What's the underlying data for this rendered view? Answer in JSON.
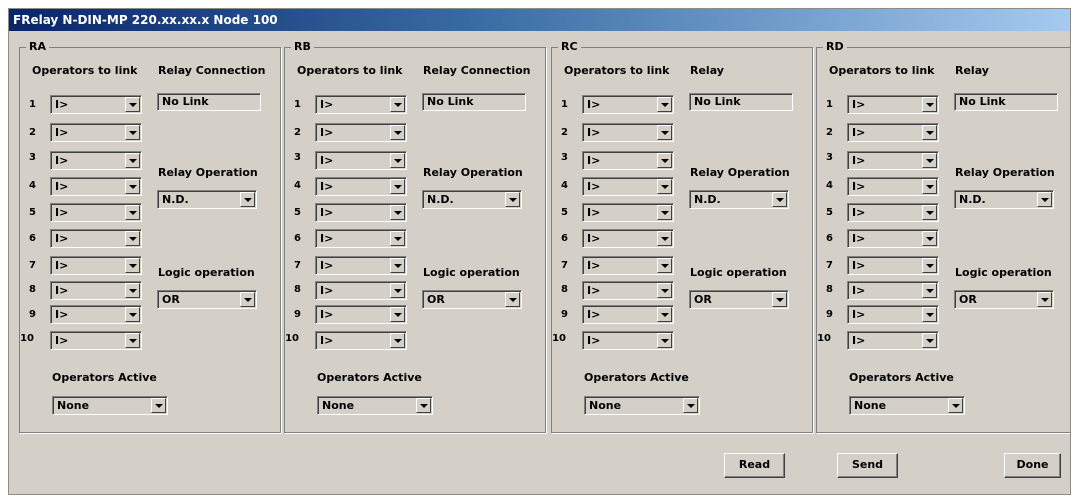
{
  "window": {
    "title": "FRelay N-DIN-MP 220.xx.xx.x Node 100"
  },
  "panels": [
    {
      "name": "RA",
      "operators_header": "Operators to link",
      "relay_header": "Relay Connection",
      "relay_value": "No Link",
      "relay_operation_label": "Relay Operation",
      "relay_operation_value": "N.D.",
      "logic_label": "Logic operation",
      "logic_value": "OR",
      "operators_active_label": "Operators Active",
      "operators_active_value": "None",
      "operators": [
        "I>",
        "I>",
        "I>",
        "I>",
        "I>",
        "I>",
        "I>",
        "I>",
        "I>",
        "I>"
      ]
    },
    {
      "name": "RB",
      "operators_header": "Operators to link",
      "relay_header": "Relay Connection",
      "relay_value": "No Link",
      "relay_operation_label": "Relay Operation",
      "relay_operation_value": "N.D.",
      "logic_label": "Logic operation",
      "logic_value": "OR",
      "operators_active_label": "Operators Active",
      "operators_active_value": "None",
      "operators": [
        "I>",
        "I>",
        "I>",
        "I>",
        "I>",
        "I>",
        "I>",
        "I>",
        "I>",
        "I>"
      ]
    },
    {
      "name": "RC",
      "operators_header": "Operators to link",
      "relay_header": "Relay",
      "relay_value": "No Link",
      "relay_operation_label": "Relay Operation",
      "relay_operation_value": "N.D.",
      "logic_label": "Logic operation",
      "logic_value": "OR",
      "operators_active_label": "Operators Active",
      "operators_active_value": "None",
      "operators": [
        "I>",
        "I>",
        "I>",
        "I>",
        "I>",
        "I>",
        "I>",
        "I>",
        "I>",
        "I>"
      ]
    },
    {
      "name": "RD",
      "operators_header": "Operators to link",
      "relay_header": "Relay",
      "relay_value": "No Link",
      "relay_operation_label": "Relay Operation",
      "relay_operation_value": "N.D.",
      "logic_label": "Logic operation",
      "logic_value": "OR",
      "operators_active_label": "Operators Active",
      "operators_active_value": "None",
      "operators": [
        "I>",
        "I>",
        "I>",
        "I>",
        "I>",
        "I>",
        "I>",
        "I>",
        "I>",
        "I>"
      ]
    }
  ],
  "operator_numbers": [
    "1",
    "2",
    "3",
    "4",
    "5",
    "6",
    "7",
    "8",
    "9",
    "10"
  ],
  "buttons": {
    "read": "Read",
    "send": "Send",
    "done": "Done"
  }
}
